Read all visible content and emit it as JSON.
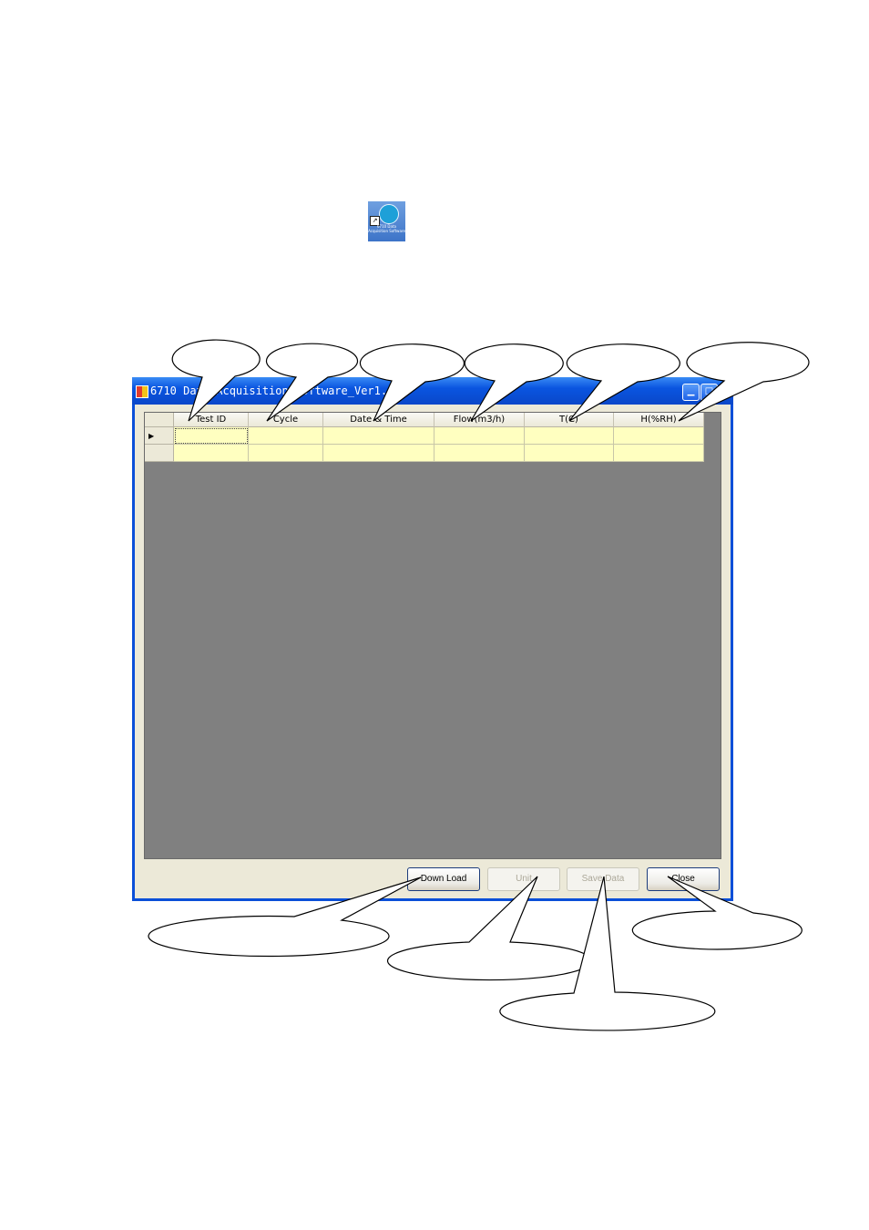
{
  "desktop_icon": {
    "name": "desktop-shortcut-icon",
    "caption": "6710 Data Acquisition Software"
  },
  "window": {
    "title": "6710  Data Acquisition Software_Ver1.00",
    "controls": {
      "minimize": "▁",
      "maximize": "□"
    }
  },
  "grid": {
    "columns": [
      "Test ID",
      "Cycle",
      "Date & Time",
      "Flow(m3/h)",
      "T(C)",
      "H(%RH)"
    ],
    "rows": [
      {
        "indicator": "▶",
        "cells": [
          "",
          "",
          "",
          "",
          "",
          ""
        ]
      },
      {
        "indicator": "",
        "cells": [
          "",
          "",
          "",
          "",
          "",
          ""
        ]
      }
    ]
  },
  "buttons": {
    "download": "Down Load",
    "unit": "Unit",
    "save_data": "Save Data",
    "close": "Close"
  },
  "colors": {
    "grid_background": "#808080",
    "cell_background": "#ffffc0",
    "titlebar": "#0a55e0"
  }
}
